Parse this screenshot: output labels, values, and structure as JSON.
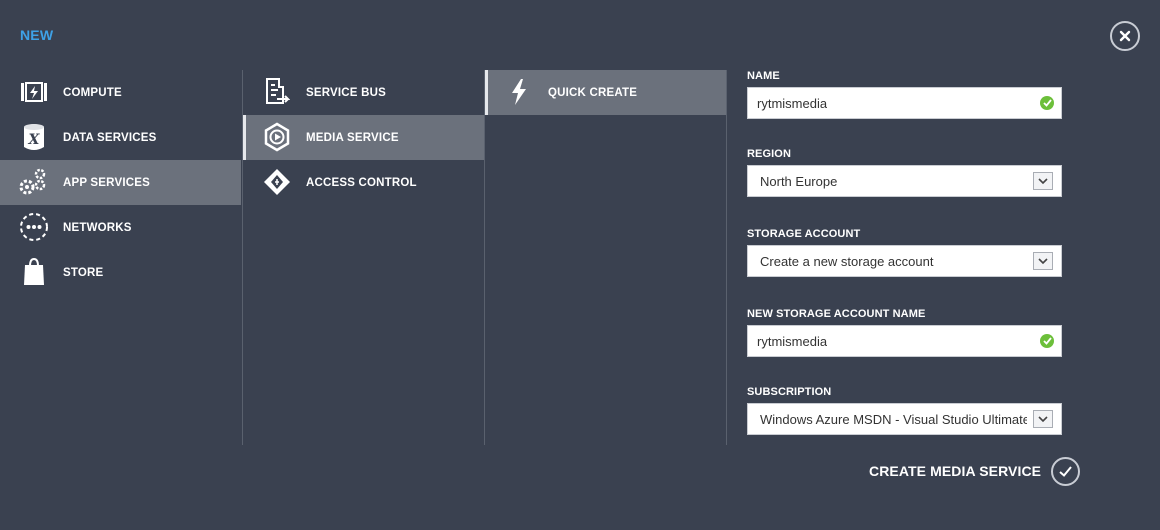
{
  "dialog": {
    "title": "NEW"
  },
  "categories": [
    {
      "label": "COMPUTE",
      "icon": "compute-icon"
    },
    {
      "label": "DATA SERVICES",
      "icon": "database-icon"
    },
    {
      "label": "APP SERVICES",
      "icon": "gears-icon"
    },
    {
      "label": "NETWORKS",
      "icon": "network-icon"
    },
    {
      "label": "STORE",
      "icon": "shopping-bag-icon"
    }
  ],
  "services": [
    {
      "label": "SERVICE BUS",
      "icon": "service-bus-icon"
    },
    {
      "label": "MEDIA SERVICE",
      "icon": "media-service-icon"
    },
    {
      "label": "ACCESS CONTROL",
      "icon": "access-control-icon"
    }
  ],
  "actions": [
    {
      "label": "QUICK CREATE",
      "icon": "lightning-icon"
    }
  ],
  "form": {
    "name": {
      "label": "NAME",
      "value": "rytmismedia"
    },
    "region": {
      "label": "REGION",
      "value": "North Europe"
    },
    "storage": {
      "label": "STORAGE ACCOUNT",
      "value": "Create a new storage account"
    },
    "new_storage_name": {
      "label": "NEW STORAGE ACCOUNT NAME",
      "value": "rytmismedia"
    },
    "subscription": {
      "label": "SUBSCRIPTION",
      "value": "Windows Azure MSDN - Visual Studio Ultimate"
    }
  },
  "submit": {
    "label": "CREATE MEDIA SERVICE"
  },
  "colors": {
    "background": "#3a4150",
    "title": "#3ea1e6",
    "selected": "#6b717c",
    "valid": "#6cbf3a"
  }
}
